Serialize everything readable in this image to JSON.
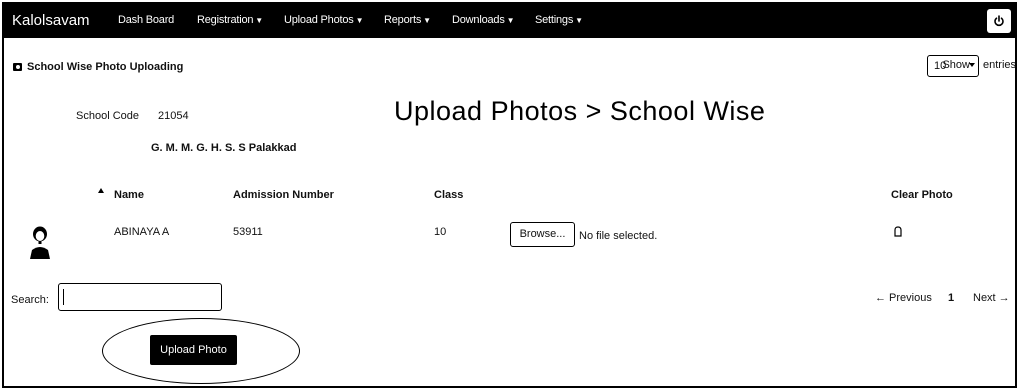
{
  "navbar": {
    "brand": "Kalolsavam",
    "items": [
      {
        "label": "Dash Board",
        "has_caret": false
      },
      {
        "label": "Registration",
        "has_caret": true
      },
      {
        "label": "Upload Photos",
        "has_caret": true
      },
      {
        "label": "Reports",
        "has_caret": true
      },
      {
        "label": "Downloads",
        "has_caret": true
      },
      {
        "label": "Settings",
        "has_caret": true
      }
    ],
    "power_icon": "power-icon"
  },
  "page": {
    "heading": "School Wise Photo Uploading",
    "heading_icon": "camera-icon",
    "overlay_title": "Upload Photos > School Wise"
  },
  "entries": {
    "show_label": "Show",
    "selected": "10",
    "suffix": "entries"
  },
  "school": {
    "code_label": "School Code",
    "code_value": "21054",
    "name": "G. M. M. G. H. S. S Palakkad"
  },
  "table": {
    "columns": [
      "Name",
      "Admission Number",
      "Class",
      "Clear Photo"
    ],
    "rows": [
      {
        "name": "ABINAYA A",
        "admission_number": "53911",
        "class": "10",
        "browse_label": "Browse...",
        "file_status": "No file selected.",
        "avatar_icon": "student-avatar-icon",
        "clear_icon": "clear-photo-icon"
      }
    ]
  },
  "search": {
    "label": "Search:",
    "value": ""
  },
  "pagination": {
    "previous": "← Previous",
    "current": "1",
    "next": "Next →"
  },
  "actions": {
    "upload_label": "Upload Photo"
  },
  "colors": {
    "navbar_bg": "#000000",
    "navbar_text": "#ffffff",
    "button_bg": "#000000"
  }
}
